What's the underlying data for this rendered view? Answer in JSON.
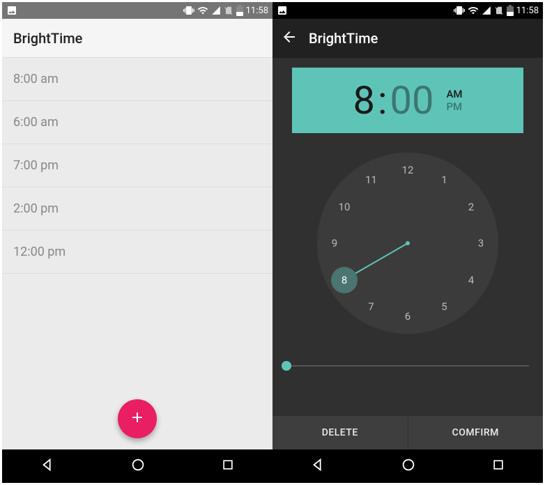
{
  "status": {
    "time": "11:58"
  },
  "left": {
    "title": "BrightTime",
    "items": [
      {
        "label": "8:00 am"
      },
      {
        "label": "6:00 am"
      },
      {
        "label": "7:00 pm"
      },
      {
        "label": "2:00 pm"
      },
      {
        "label": "12:00 pm"
      }
    ]
  },
  "right": {
    "title": "BrightTime",
    "picker": {
      "hour": "8",
      "minute": "00",
      "am": "AM",
      "pm": "PM",
      "selected_period": "AM"
    },
    "clock": {
      "numbers": [
        "12",
        "1",
        "2",
        "3",
        "4",
        "5",
        "6",
        "7",
        "8",
        "9",
        "10",
        "11"
      ],
      "selected": "8"
    },
    "buttons": {
      "delete": "DELETE",
      "confirm": "COMFIRM"
    }
  }
}
